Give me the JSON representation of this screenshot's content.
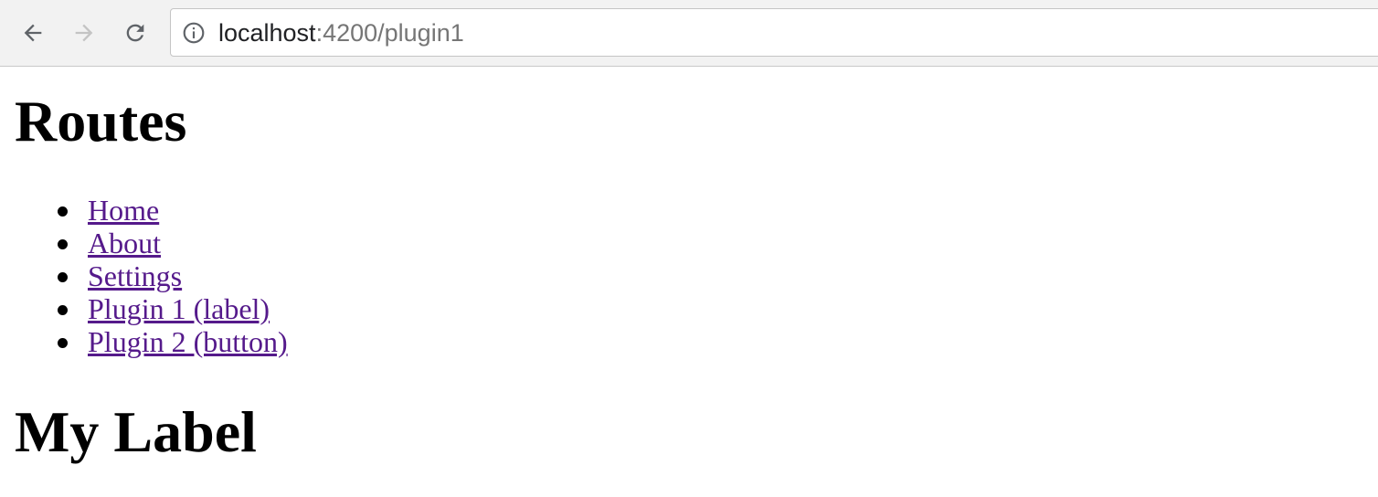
{
  "browser": {
    "url_host": "localhost",
    "url_rest": ":4200/plugin1",
    "back_icon": "back-arrow-icon",
    "forward_icon": "forward-arrow-icon",
    "reload_icon": "reload-icon",
    "info_icon": "info-icon"
  },
  "page": {
    "routes_heading": "Routes",
    "nav": [
      {
        "label": "Home"
      },
      {
        "label": "About"
      },
      {
        "label": "Settings"
      },
      {
        "label": "Plugin 1 (label)"
      },
      {
        "label": "Plugin 2 (button)"
      }
    ],
    "label_heading": "My Label"
  },
  "colors": {
    "link_visited": "#551a8b",
    "toolbar_bg": "#f2f2f2"
  }
}
